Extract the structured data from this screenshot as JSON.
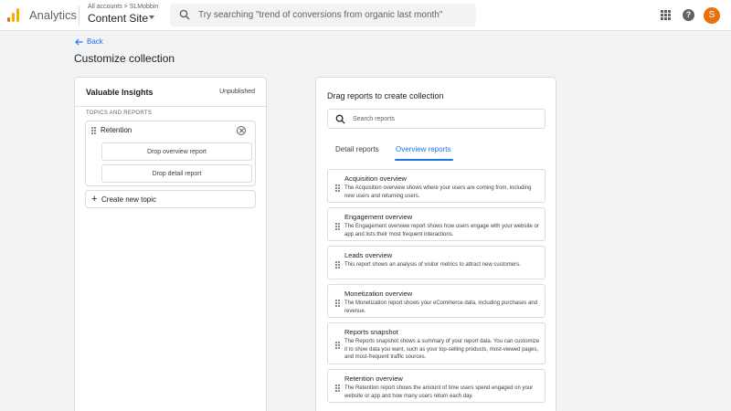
{
  "header": {
    "app_name": "Analytics",
    "account_crumb": "All accounts > SLMobbin",
    "property_name": "Content Site",
    "search_placeholder": "Try searching \"trend of conversions from organic last month\"",
    "avatar_initial": "S",
    "help_label": "?",
    "icons": [
      "analytics-logo-icon",
      "search-icon",
      "apps-icon",
      "help-icon"
    ],
    "colors": {
      "logo_dark": "#e37400",
      "logo_light": "#f9ab00",
      "avatar": "#e8710a",
      "accent": "#1a73e8"
    }
  },
  "page": {
    "back_label": "Back",
    "title": "Customize collection"
  },
  "collection": {
    "name": "Valuable Insights",
    "status": "Unpublished",
    "section_label": "TOPICS AND REPORTS",
    "topic": {
      "name": "Retention",
      "drop_overview": "Drop overview report",
      "drop_detail": "Drop detail report"
    },
    "create_topic_label": "Create new topic"
  },
  "library": {
    "title": "Drag reports to create collection",
    "search_placeholder": "Search reports",
    "tabs": [
      {
        "label": "Detail reports",
        "active": false
      },
      {
        "label": "Overview reports",
        "active": true
      }
    ],
    "reports": [
      {
        "title": "Acquisition overview",
        "desc": "The Acquisition overview shows where your users are coming from, including new users and returning users."
      },
      {
        "title": "Engagement overview",
        "desc": "The Engagement overview report shows how users engage with your website or app and lists their most frequent interactions."
      },
      {
        "title": "Leads overview",
        "desc": "This report shows an analysis of visitor metrics to attract new customers."
      },
      {
        "title": "Monetization overview",
        "desc": "The Monetization report shows your eCommerce data, including purchases and revenue."
      },
      {
        "title": "Reports snapshot",
        "desc": "The Reports snapshot shows a summary of your report data. You can customize it to show data you want, such as your top-selling products, most-viewed pages, and most-frequent traffic sources."
      },
      {
        "title": "Retention overview",
        "desc": "The Retention report shows the amount of time users spend engaged on your website or app and how many users return each day."
      }
    ]
  }
}
